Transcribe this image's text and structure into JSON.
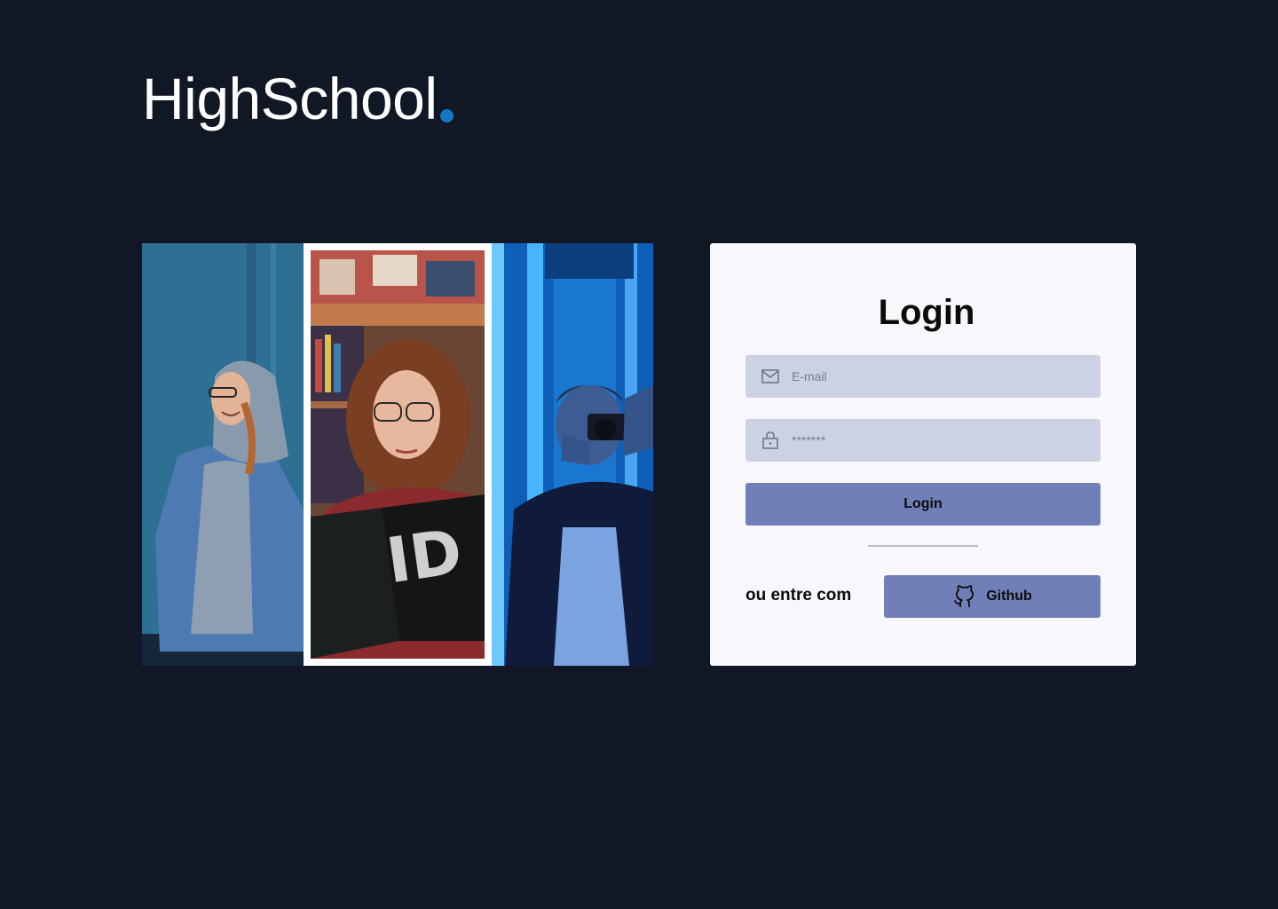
{
  "brand": {
    "name": "HighSchool",
    "dot_color": "#1379c4"
  },
  "hero": {
    "panels": [
      {
        "icon": "photo-hooded-student"
      },
      {
        "icon": "photo-reading-student"
      },
      {
        "icon": "photo-camera-student"
      }
    ]
  },
  "login": {
    "title": "Login",
    "email_placeholder": "E-mail",
    "password_placeholder": "*******",
    "submit_label": "Login",
    "alt_label": "ou entre com",
    "github_label": "Github"
  },
  "colors": {
    "background": "#121726",
    "card": "#f8f8fc",
    "input": "#cdd1e4",
    "button": "#707fb8"
  }
}
